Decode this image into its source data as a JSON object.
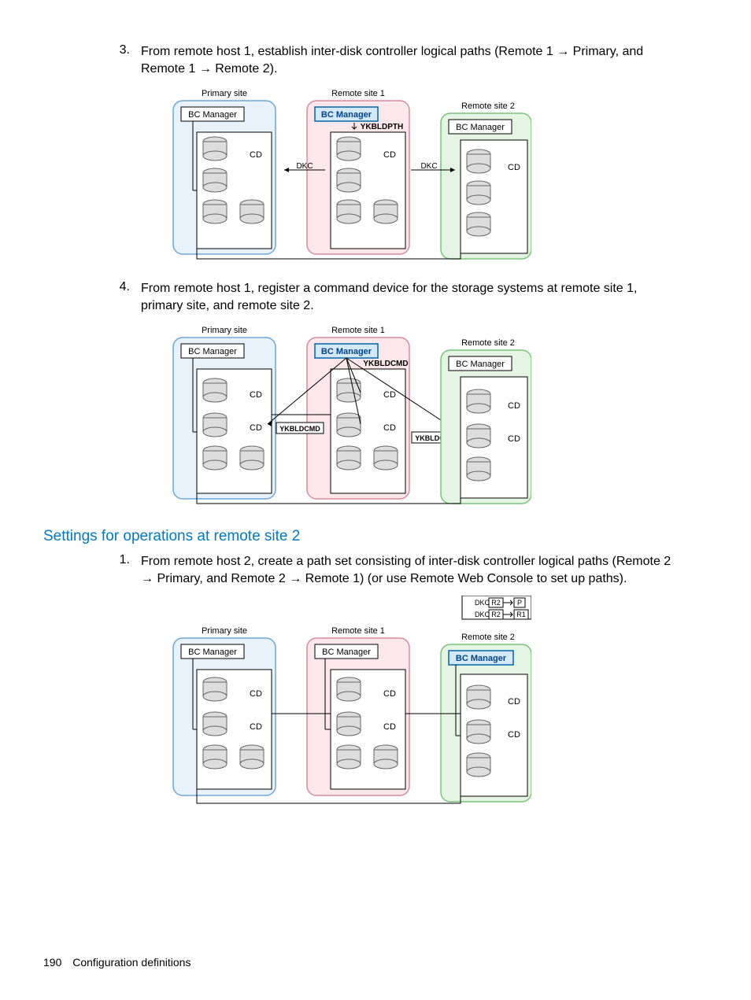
{
  "steps": {
    "s3": {
      "num": "3.",
      "text_a": "From remote host 1, establish inter-disk controller logical paths (Remote 1 ",
      "arrow1": "→",
      "text_b": " Primary, and Remote 1 ",
      "arrow2": "→",
      "text_c": " Remote 2)."
    },
    "s4": {
      "num": "4.",
      "text": "From remote host 1, register a command device for the storage systems at remote site 1, primary site, and remote site 2."
    },
    "r1": {
      "num": "1.",
      "text_a": "From remote host 2, create a path set consisting of inter-disk controller logical paths (Remote 2 ",
      "arrow1": "→",
      "text_b": " Primary, and Remote 2 ",
      "arrow2": "→",
      "text_c": " Remote 1) (or use Remote Web Console to set up paths)."
    }
  },
  "heading": "Settings for operations at remote site 2",
  "labels": {
    "primary": "Primary site",
    "remote1": "Remote site 1",
    "remote2": "Remote site 2",
    "bcm": "BC Manager",
    "cd": "CD",
    "ykbldpth": "YKBLDPTH",
    "ykbldcmd": "YKBLDCMD",
    "dkc_left": "DKC",
    "dkc_right": "DKC",
    "dkc_r2_p": "DKC",
    "r2": "R2",
    "p": "P",
    "r1": "R1"
  },
  "footer": {
    "page": "190",
    "title": "Configuration definitions"
  }
}
